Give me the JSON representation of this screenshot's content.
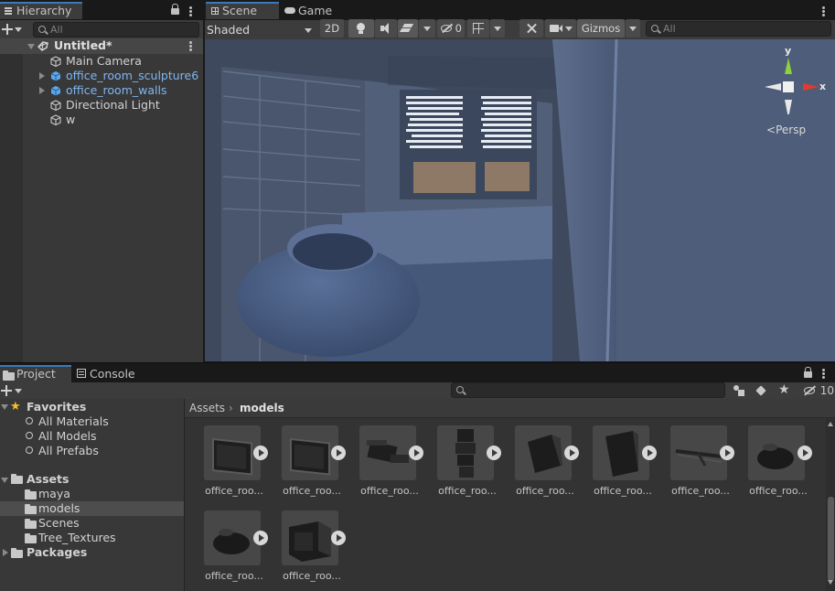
{
  "hierarchy": {
    "tab_label": "Hierarchy",
    "search_placeholder": "All",
    "scene_name": "Untitled*",
    "items": [
      {
        "label": "Main Camera",
        "prefab": false,
        "expandable": false
      },
      {
        "label": "office_room_sculpture6",
        "prefab": true,
        "expandable": true
      },
      {
        "label": "office_room_walls",
        "prefab": true,
        "expandable": true
      },
      {
        "label": "Directional Light",
        "prefab": false,
        "expandable": false
      },
      {
        "label": "w",
        "prefab": false,
        "expandable": false
      }
    ]
  },
  "scene_view": {
    "tabs": [
      {
        "label": "Scene",
        "icon": "grid-icon"
      },
      {
        "label": "Game",
        "icon": "gamepad-icon"
      }
    ],
    "shading_mode": "Shaded",
    "toggle_2d": "2D",
    "hidden_count": "0",
    "gizmos_label": "Gizmos",
    "search_placeholder": "All",
    "axis_y": "y",
    "axis_x": "x",
    "projection_label": "Persp"
  },
  "project": {
    "tabs": [
      {
        "label": "Project",
        "icon": "folder-icon"
      },
      {
        "label": "Console",
        "icon": "console-icon"
      }
    ],
    "hidden_count": "10",
    "favorites_label": "Favorites",
    "favorites": [
      "All Materials",
      "All Models",
      "All Prefabs"
    ],
    "assets_label": "Assets",
    "asset_folders": [
      "maya",
      "models",
      "Scenes",
      "Tree_Textures"
    ],
    "selected_folder": "models",
    "packages_label": "Packages",
    "breadcrumb": [
      "Assets",
      "models"
    ],
    "assets": [
      {
        "label": "office_roo...",
        "icon": "monitor-model-icon"
      },
      {
        "label": "office_roo...",
        "icon": "monitor-model-icon"
      },
      {
        "label": "office_roo...",
        "icon": "stapler-model-icon"
      },
      {
        "label": "office_roo...",
        "icon": "stack-model-icon"
      },
      {
        "label": "office_roo...",
        "icon": "box-model-icon"
      },
      {
        "label": "office_roo...",
        "icon": "bin-model-icon"
      },
      {
        "label": "office_roo...",
        "icon": "rail-model-icon"
      },
      {
        "label": "office_roo...",
        "icon": "sculpture-model-icon"
      },
      {
        "label": "office_roo...",
        "icon": "sculpture-model-icon"
      },
      {
        "label": "office_roo...",
        "icon": "crate-model-icon"
      }
    ]
  },
  "colors": {
    "accent": "#3a79bb",
    "prefab_text": "#7fb6f2",
    "panel": "#383838"
  }
}
